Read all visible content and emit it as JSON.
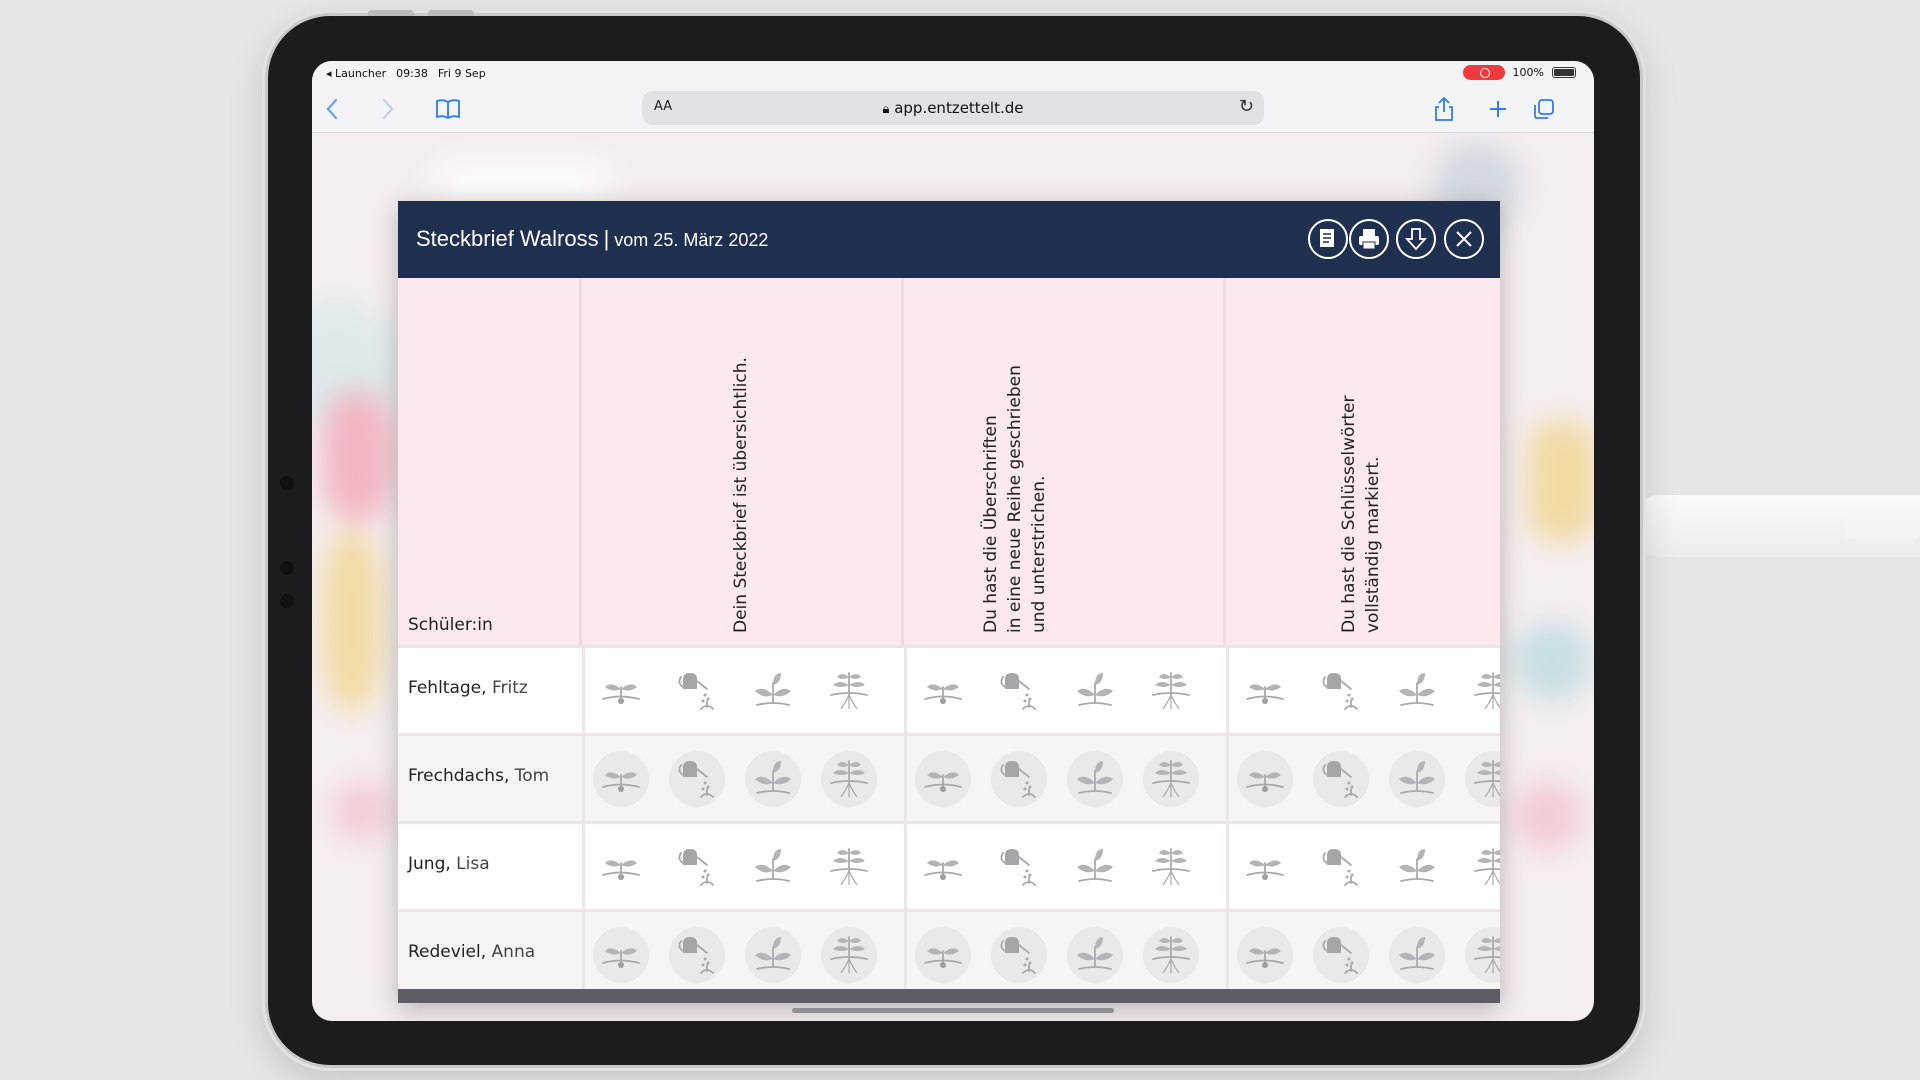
{
  "status_bar": {
    "back_app": "◂ Launcher",
    "time": "09:38",
    "date": "Fri 9 Sep",
    "battery": "100%"
  },
  "browser": {
    "url": "app.entzettelt.de",
    "text_size_button": "AA",
    "icons": [
      "chevron-left-icon",
      "chevron-right-icon",
      "book-icon",
      "lock-icon",
      "reload-icon",
      "share-icon",
      "plus-icon",
      "tabs-icon"
    ]
  },
  "modal": {
    "title": "Steckbrief Walross",
    "separator": "|",
    "subtitle": "vom 25. März 2022",
    "actions": [
      "document-icon",
      "print-icon",
      "download-icon",
      "close-icon"
    ],
    "header_color": "#1f2f4f",
    "table": {
      "name_header": "Schüler:in",
      "criteria": [
        {
          "lines": [
            "Dein Steckbrief ist übersichtlich."
          ]
        },
        {
          "lines": [
            "Du hast die Überschriften",
            "in eine neue Reihe geschrieben",
            "und unterstrichen."
          ]
        },
        {
          "lines": [
            "Du hast die Schlüsselwörter",
            "vollständig markiert."
          ]
        }
      ],
      "rating_icons": [
        "seed-sprout-icon",
        "watering-can-icon",
        "seedling-icon",
        "plant-roots-icon"
      ],
      "students": [
        {
          "last": "Fehltage",
          "first": "Fritz"
        },
        {
          "last": "Frechdachs",
          "first": "Tom"
        },
        {
          "last": "Jung",
          "first": "Lisa"
        },
        {
          "last": "Redeviel",
          "first": "Anna"
        }
      ]
    }
  }
}
